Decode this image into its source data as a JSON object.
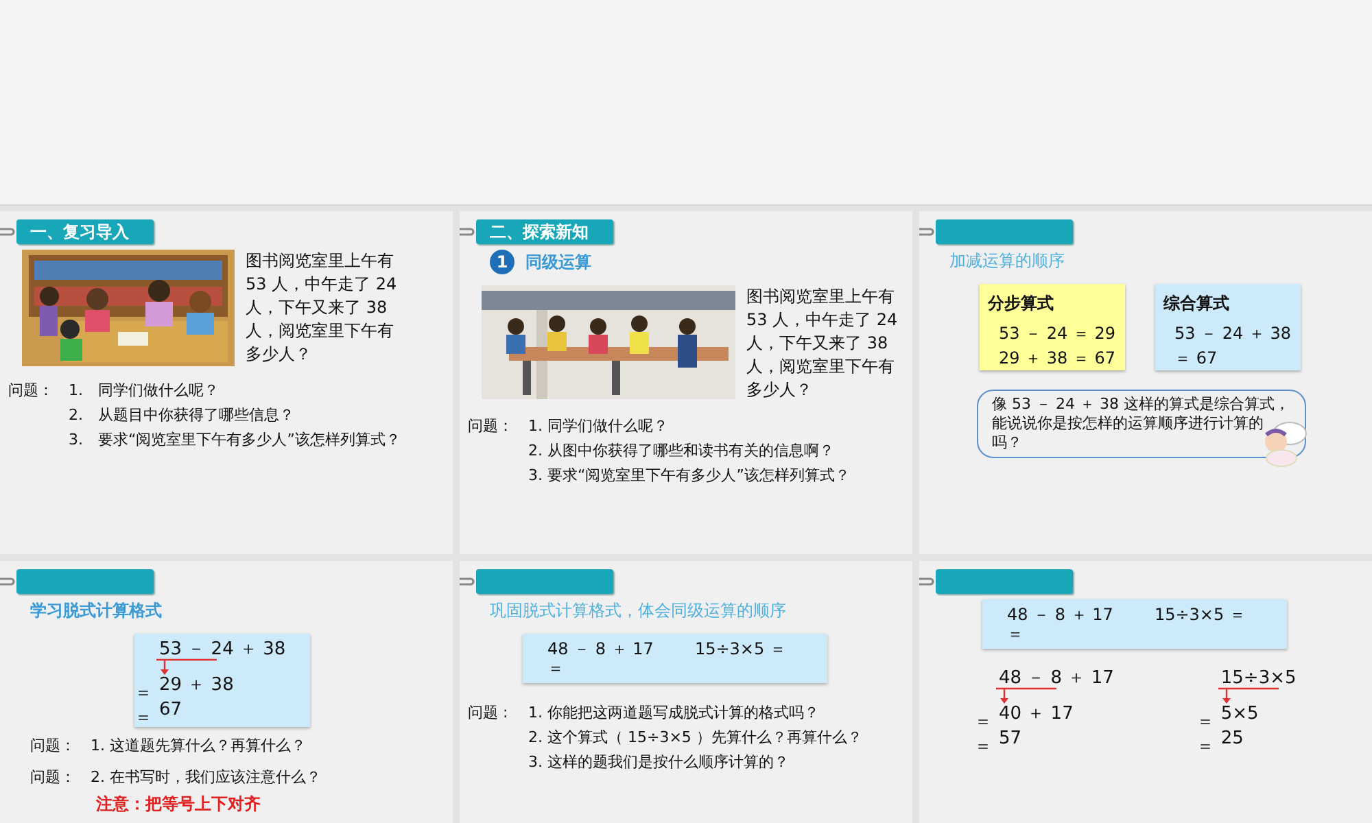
{
  "slides": [
    {
      "section": "一、复习导入",
      "selected": false,
      "blocks": [
        {
          "kind": "picture_story",
          "story": "图书阅览室里上午有 53 人，中午走了 24 人，下午又来了 38 人，阅览室里下午有多少人？"
        },
        {
          "kind": "questions",
          "items": [
            {
              "label": "问题：",
              "text": "1.　同学们做什么呢？"
            },
            {
              "text": "2.　从题目中你获得了哪些信息？"
            },
            {
              "text": "3.　要求“阅览室里下午有多少人”该怎样列算式？"
            }
          ]
        }
      ]
    },
    {
      "section": "二、探索新知",
      "selected": false,
      "blocks": [
        {
          "kind": "subtitle",
          "badge": "1",
          "text": "同级运算",
          "bold": true
        },
        {
          "kind": "picture_story",
          "story": "图书阅览室里上午有 53 人，中午走了 24 人，下午又来了 38 人，阅览室里下午有多少人？"
        },
        {
          "kind": "questions",
          "items": [
            {
              "label": "问题：",
              "text": "1. 同学们做什么呢？"
            },
            {
              "text": "2. 从图中你获得了哪些和读书有关的信息啊？"
            },
            {
              "text": "3. 要求“阅览室里下午有多少人”该怎样列算式？"
            }
          ]
        }
      ]
    },
    {
      "selected": false,
      "blocks": [
        {
          "kind": "subtitle",
          "text": "加减运算的顺序",
          "bold": false
        },
        {
          "kind": "step_boxes",
          "boxes": [
            {
              "title": "分步算式",
              "color": "#ffff99",
              "lines": [
                "53 － 24 ＝ 29",
                "29 ＋ 38 ＝ 67"
              ]
            },
            {
              "title": "综合算式",
              "color": "#cdeafb",
              "lines": [
                "53 － 24 ＋ 38 ＝ 67"
              ]
            }
          ]
        },
        {
          "kind": "bubble",
          "text": "像 53 － 24 ＋ 38 这样的算式是综合算式，能说说你是按怎样的运算顺序进行计算的吗？"
        }
      ]
    },
    {
      "selected": false,
      "blocks": [
        {
          "kind": "subtitle",
          "text": "学习脱式计算格式",
          "bold": true
        },
        {
          "kind": "derivation_box",
          "derivation": {
            "expr": "53 － 24 ＋ 38",
            "steps": [
              {
                "sign": "＝",
                "value": "29 ＋ 38"
              },
              {
                "sign": "＝",
                "value": "67"
              }
            ]
          }
        },
        {
          "kind": "questions",
          "items": [
            {
              "label": "问题：",
              "text": "1. 这道题先算什么？再算什么？"
            },
            {
              "label": "问题：",
              "text": "2. 在书写时，我们应该注意什么？"
            }
          ]
        },
        {
          "kind": "note",
          "text": "注意：把等号上下对齐"
        }
      ]
    },
    {
      "selected": false,
      "blocks": [
        {
          "kind": "subtitle",
          "text": "巩固脱式计算格式，体会同级运算的顺序",
          "bold": false
        },
        {
          "kind": "exercise_box",
          "items": [
            {
              "expr": "48 － 8 ＋ 17",
              "below": "＝"
            },
            {
              "expr": "15÷3×5 ＝"
            }
          ]
        },
        {
          "kind": "questions",
          "items": [
            {
              "label": "问题 :",
              "text": "1. 你能把这两道题写成脱式计算的格式吗？"
            },
            {
              "text": "2. 这个算式（ 15÷3×5 ）先算什么？再算什么？"
            },
            {
              "text": "3. 这样的题我们是按什么顺序计算的？"
            }
          ]
        }
      ]
    },
    {
      "selected": false,
      "blocks": [
        {
          "kind": "exercise_box",
          "items": [
            {
              "expr": "48 － 8 ＋ 17",
              "below": "＝"
            },
            {
              "expr": "15÷3×5 ＝"
            }
          ]
        },
        {
          "kind": "derivations",
          "items": [
            {
              "expr": "48 － 8 ＋ 17",
              "steps": [
                {
                  "sign": "＝",
                  "value": "40 ＋ 17"
                },
                {
                  "sign": "＝",
                  "value": "57"
                }
              ]
            },
            {
              "expr": "15÷3×5",
              "steps": [
                {
                  "sign": "＝",
                  "value": "5×5"
                },
                {
                  "sign": "＝",
                  "value": "25"
                }
              ]
            }
          ]
        }
      ]
    }
  ]
}
